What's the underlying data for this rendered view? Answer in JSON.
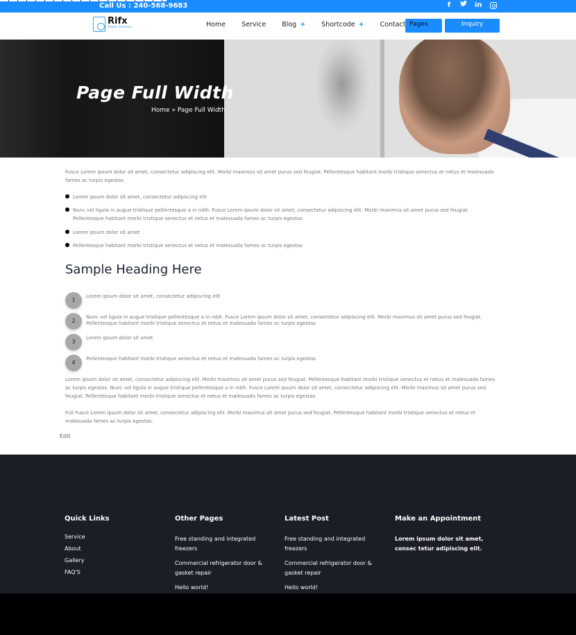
{
  "topbar": {
    "call_us": "Call Us : 240-568-9683",
    "social": [
      {
        "icon": "facebook-icon",
        "glyph": "f"
      },
      {
        "icon": "twitter-icon",
        "glyph": "🐦"
      },
      {
        "icon": "linkedin-icon",
        "glyph": "in"
      },
      {
        "icon": "instagram-icon",
        "glyph": ""
      }
    ]
  },
  "header": {
    "logo_name": "Rifx",
    "logo_sub": "Repair Services",
    "nav": [
      {
        "label": "Home",
        "has_submenu": false
      },
      {
        "label": "Service",
        "has_submenu": false
      },
      {
        "label": "Blog",
        "has_submenu": true
      },
      {
        "label": "Shortcode",
        "has_submenu": true
      },
      {
        "label": "Contact Us",
        "has_submenu": false
      }
    ],
    "plus": "+",
    "pages_button": "Pages",
    "inquiry_button": "Inquiry"
  },
  "hero": {
    "title": "Page Full Width",
    "breadcrumb_home": "Home",
    "breadcrumb_sep": "»",
    "breadcrumb_current": "Page Full Width"
  },
  "content": {
    "intro": "Fusce Lorem ipsum dolor sit amet, consectetur adipiscing elit. Morbi maximus sit amet purus sed feugiat. Pellentesque habitant morbi tristique senectus et netus et malesuada fames ac turpis egestas.",
    "bullets": [
      "Lorem ipsum dolor sit amet, consectetur adipiscing elit",
      "Nunc vel ligula in augue tristique pellentesque a in nibh. Fusce Lorem ipsum dolor sit amet, consectetur adipiscing elit. Morbi maximus sit amet purus sed feugiat. Pellentesque habitant morbi tristique senectus et netus et malesuada fames ac turpis egestas",
      "Lorem ipsum dolor sit amet",
      "Pellentesque habitant morbi tristique senectus et netus et malesuada fames ac turpis egestas"
    ],
    "heading": "Sample Heading Here",
    "numbered": [
      {
        "n": "1",
        "text": "Lorem ipsum dolor sit amet, consectetur adipiscing elit"
      },
      {
        "n": "2",
        "text": "Nunc vel ligula in augue tristique pellentesque a in nibh. Fusce Lorem ipsum dolor sit amet, consectetur adipiscing elit. Morbi maximus sit amet purus sed feugiat. Pellentesque habitant morbi tristique senectus et netus et malesuada fames ac turpis egestas"
      },
      {
        "n": "3",
        "text": "Lorem ipsum dolor sit amet"
      },
      {
        "n": "4",
        "text": "Pellentesque habitant morbi tristique senectus et netus et malesuada fames ac turpis egestas"
      }
    ],
    "para2": "Lorem ipsum dolor sit amet, consectetur adipiscing elit. Morbi maximus sit amet purus sed feugiat. Pellentesque habitant morbi tristique senectus et netus et malesuada fames ac turpis egestas. Nunc vel ligula in augue tristique pellentesque a in nibh. Fusce Lorem ipsum dolor sit amet, consectetur adipiscing elit. Morbi maximus sit amet purus sed feugiat. Pellentesque habitant morbi tristique senectus et netus et malesuada fames ac turpis egestas.",
    "para3": "Full Fusce Lorem ipsum dolor sit amet, consectetur adipiscing elit. Morbi maximus sit amet purus sed feugiat. Pellentesque habitant morbi tristique senectus et netus et malesuada fames ac turpis egestas.",
    "edit_link": "Edit"
  },
  "footer": {
    "quick_links": {
      "title": "Quick Links",
      "items": [
        "Service",
        "About",
        "Gallery",
        "FAQ'S"
      ]
    },
    "other_pages": {
      "title": "Other Pages",
      "items": [
        "Free standing and integrated freezers",
        "Commercial refrigerator door & gasket repair",
        "Hello world!"
      ]
    },
    "latest_post": {
      "title": "Latest Post",
      "items": [
        "Free standing and integrated freezers",
        "Commercial refrigerator door & gasket repair",
        "Hello world!"
      ]
    },
    "appointment": {
      "title": "Make an Appointment",
      "text": "Lorem ipsum dolor sit amet, consec tetur adipiscing elit."
    }
  },
  "colors": {
    "brand_blue": "#1a8cff",
    "footer_bg": "#1b1e27",
    "heading": "#1a1f33",
    "number_circle": "#aaa7a8"
  }
}
